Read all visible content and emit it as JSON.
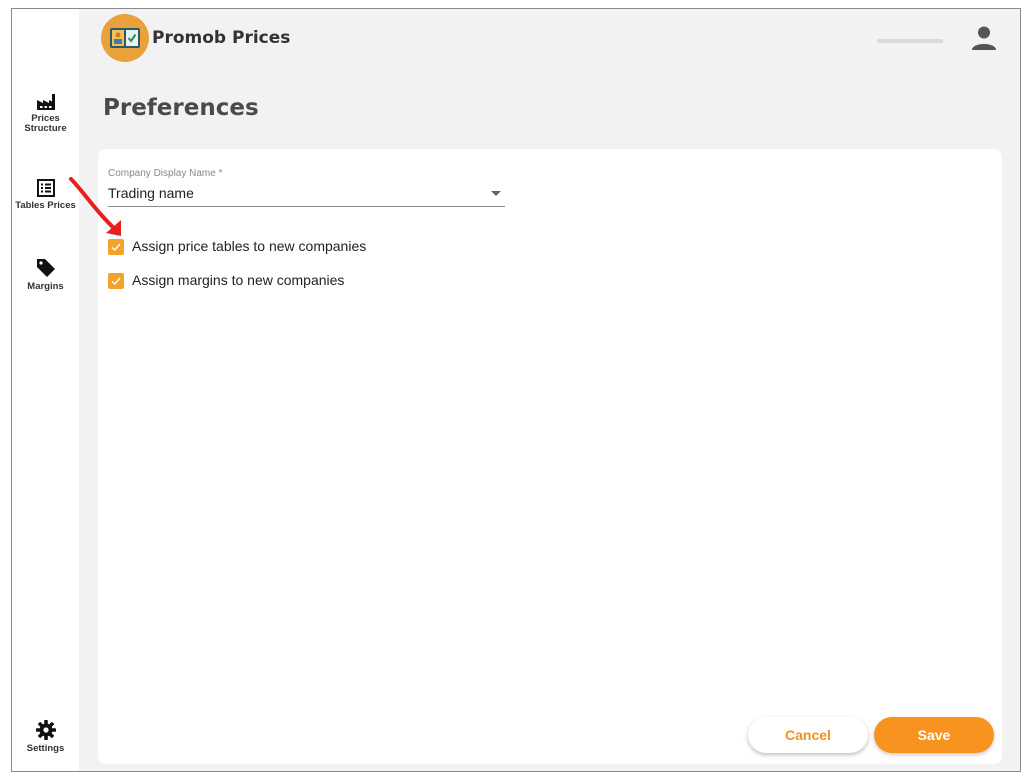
{
  "app": {
    "title": "Promob Prices"
  },
  "sidebar": {
    "items": [
      {
        "label": "Prices\nStructure",
        "icon": "factory-icon"
      },
      {
        "label": "Tables Prices",
        "icon": "list-icon"
      },
      {
        "label": "Margins",
        "icon": "tag-icon"
      },
      {
        "label": "Settings",
        "icon": "gear-icon"
      }
    ]
  },
  "header": {
    "user_icon": "account-icon"
  },
  "page": {
    "title": "Preferences"
  },
  "form": {
    "company_display_name": {
      "label": "Company Display Name *",
      "value": "Trading name"
    },
    "checkboxes": [
      {
        "label": "Assign price tables to new companies",
        "checked": true
      },
      {
        "label": "Assign margins to new companies",
        "checked": true
      }
    ],
    "cancel_label": "Cancel",
    "save_label": "Save"
  },
  "colors": {
    "accent": "#f7931e",
    "logo": "#e9a23b",
    "annotation": "#e8201c"
  }
}
